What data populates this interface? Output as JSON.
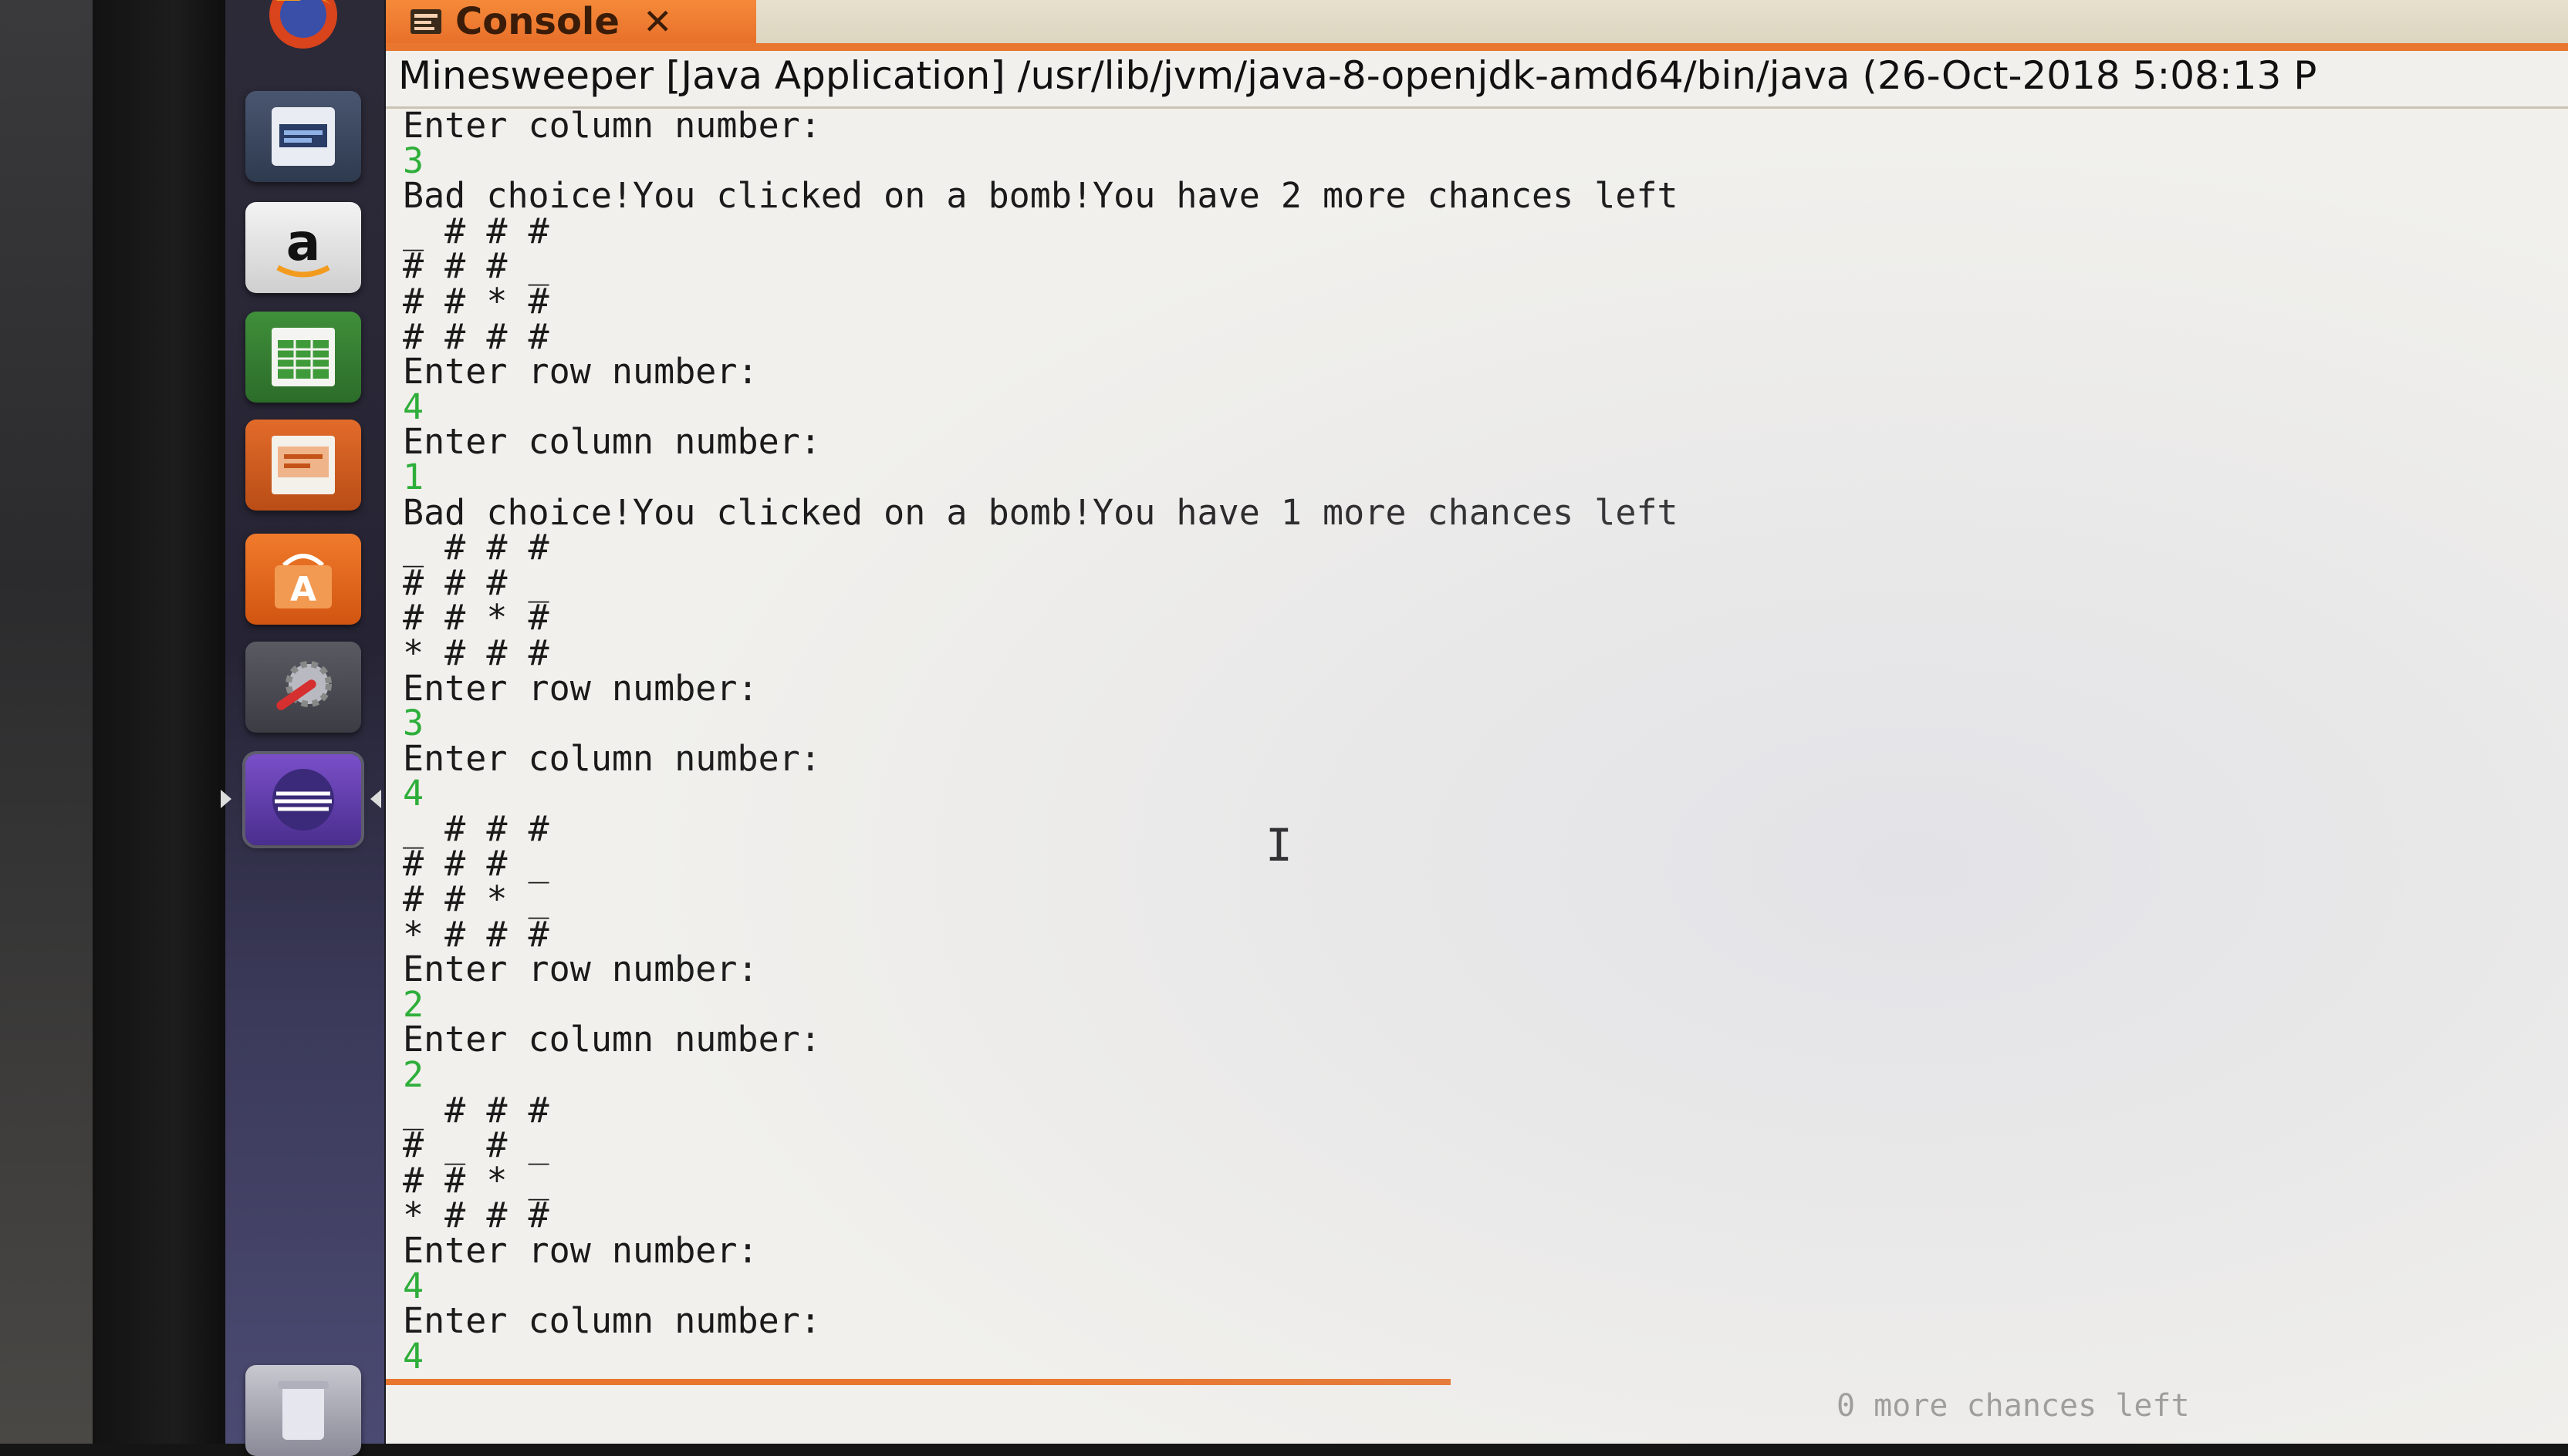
{
  "launcher": {
    "items": [
      {
        "name": "firefox"
      },
      {
        "name": "files"
      },
      {
        "name": "amazon",
        "glyph": "a"
      },
      {
        "name": "libreoffice-calc"
      },
      {
        "name": "libreoffice-impress"
      },
      {
        "name": "ubuntu-software",
        "glyph": "A"
      },
      {
        "name": "system-settings"
      },
      {
        "name": "eclipse"
      },
      {
        "name": "trash"
      }
    ]
  },
  "console": {
    "tab_label": "Console",
    "tab_close": "✕",
    "process_title": "Minesweeper [Java Application] /usr/lib/jvm/java-8-openjdk-amd64/bin/java (26-Oct-2018 5:08:13 P",
    "status_ghost": "0 more chances left",
    "lines": [
      {
        "text": "Enter column number:",
        "kind": "output"
      },
      {
        "text": "3",
        "kind": "input"
      },
      {
        "text": "Bad choice!You clicked on a bomb!You have 2 more chances left",
        "kind": "output"
      },
      {
        "text": "_ # # #",
        "kind": "output"
      },
      {
        "text": "# # # _",
        "kind": "output"
      },
      {
        "text": "# # * #",
        "kind": "output"
      },
      {
        "text": "# # # #",
        "kind": "output"
      },
      {
        "text": "Enter row number:",
        "kind": "output"
      },
      {
        "text": "4",
        "kind": "input"
      },
      {
        "text": "Enter column number:",
        "kind": "output"
      },
      {
        "text": "1",
        "kind": "input"
      },
      {
        "text": "Bad choice!You clicked on a bomb!You have 1 more chances left",
        "kind": "output"
      },
      {
        "text": "_ # # #",
        "kind": "output"
      },
      {
        "text": "# # # _",
        "kind": "output"
      },
      {
        "text": "# # * #",
        "kind": "output"
      },
      {
        "text": "* # # #",
        "kind": "output"
      },
      {
        "text": "Enter row number:",
        "kind": "output"
      },
      {
        "text": "3",
        "kind": "input"
      },
      {
        "text": "Enter column number:",
        "kind": "output"
      },
      {
        "text": "4",
        "kind": "input"
      },
      {
        "text": "_ # # #",
        "kind": "output"
      },
      {
        "text": "# # # _",
        "kind": "output"
      },
      {
        "text": "# # * _",
        "kind": "output"
      },
      {
        "text": "* # # #",
        "kind": "output"
      },
      {
        "text": "Enter row number:",
        "kind": "output"
      },
      {
        "text": "2",
        "kind": "input"
      },
      {
        "text": "Enter column number:",
        "kind": "output"
      },
      {
        "text": "2",
        "kind": "input"
      },
      {
        "text": "_ # # #",
        "kind": "output"
      },
      {
        "text": "# _ # _",
        "kind": "output"
      },
      {
        "text": "# # * _",
        "kind": "output"
      },
      {
        "text": "* # # #",
        "kind": "output"
      },
      {
        "text": "Enter row number:",
        "kind": "output"
      },
      {
        "text": "4",
        "kind": "input"
      },
      {
        "text": "Enter column number:",
        "kind": "output"
      },
      {
        "text": "4",
        "kind": "input"
      }
    ]
  },
  "colors": {
    "input_text": "#2eae3a",
    "accent_orange": "#e8762e",
    "console_bg": "#f1f0ec"
  }
}
